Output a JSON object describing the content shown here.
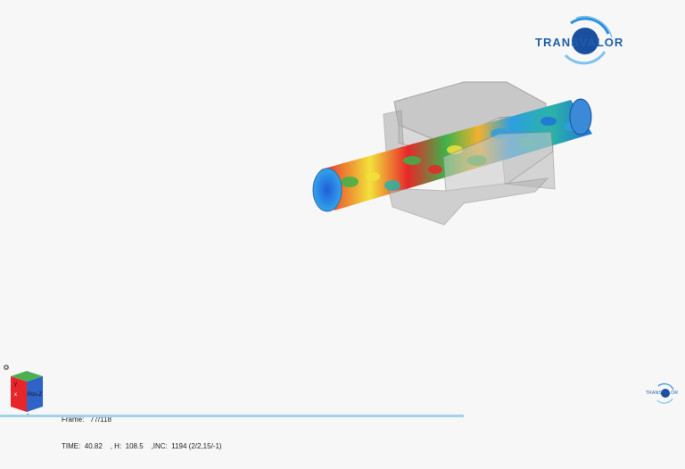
{
  "branding": {
    "logo_text": "TRANSVALOR",
    "mini_logo_text": "TRANSVALOR"
  },
  "triad": {
    "face_label": "Pos-Z",
    "axis_x": "x",
    "axis_y": "y",
    "axis_z": "z"
  },
  "status": {
    "frame_label": "Frame:",
    "frame_value": "77/118",
    "time_label": "TIME:",
    "time_value": "40.82",
    "h_label": ", H:",
    "h_value": "108.5",
    "inc_label": ",INC:",
    "inc_value": "1194 (2/2,15/-1)"
  },
  "colors": {
    "background": "#f7f7f7",
    "brand_blue": "#1f5fa8",
    "die_gray": "#9a9a9a",
    "contour_red": "#e8262a",
    "contour_yellow": "#f2e23a",
    "contour_green": "#3db24a",
    "contour_blue": "#1e74d8"
  }
}
